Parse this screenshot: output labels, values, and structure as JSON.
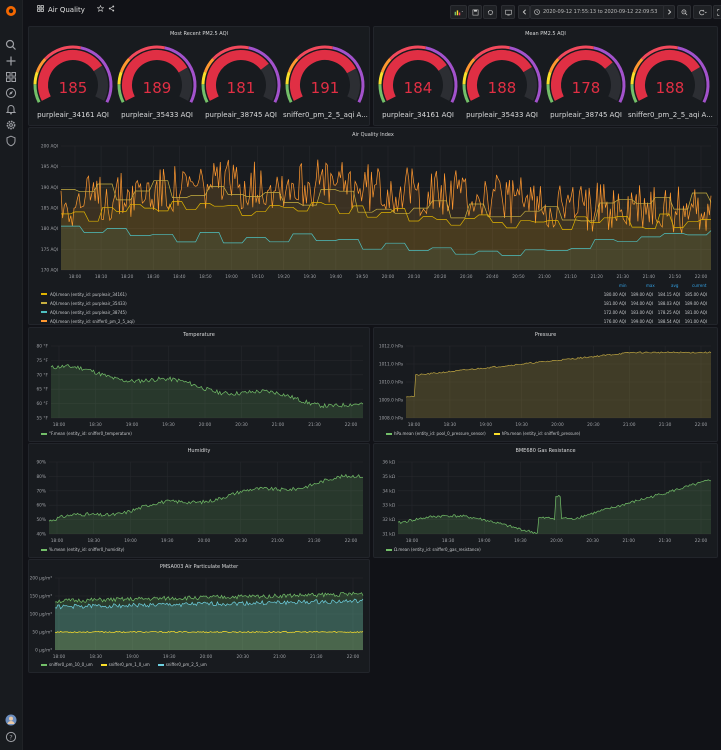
{
  "header": {
    "title": "Air Quality",
    "time_range": "2020-09-12 17:55:13 to 2020-09-12 22:09:53"
  },
  "colors": {
    "bg": "#111217",
    "panel": "#181b1f",
    "red": "#e02f44",
    "green": "#73bf69",
    "orange": "#ff9830",
    "yellow": "#fade2a",
    "teal": "#5794f2",
    "cyan": "#8ab8ff"
  },
  "most_recent": {
    "title": "Most Recent PM2.5 AQI",
    "gauges": [
      {
        "value": "185",
        "label": "purpleair_34161 AQI",
        "fraction": 0.74
      },
      {
        "value": "189",
        "label": "purpleair_35433 AQI",
        "fraction": 0.756
      },
      {
        "value": "181",
        "label": "purpleair_38745 AQI",
        "fraction": 0.724
      },
      {
        "value": "191",
        "label": "sniffer0_pm_2_5_aqi A...",
        "fraction": 0.764
      }
    ]
  },
  "mean": {
    "title": "Mean PM2.5 AQI",
    "gauges": [
      {
        "value": "184",
        "label": "purpleair_34161 AQI",
        "fraction": 0.736
      },
      {
        "value": "188",
        "label": "purpleair_35433 AQI",
        "fraction": 0.752
      },
      {
        "value": "178",
        "label": "purpleair_38745 AQI",
        "fraction": 0.712
      },
      {
        "value": "188",
        "label": "sniffer0_pm_2_5_aqi A...",
        "fraction": 0.752
      }
    ]
  },
  "aqi_panel": {
    "title": "Air Quality Index",
    "y_ticks": [
      "200 AQI",
      "195 AQI",
      "190 AQI",
      "185 AQI",
      "180 AQI",
      "175 AQI",
      "170 AQI"
    ],
    "x_ticks": [
      "18:00",
      "18:10",
      "18:20",
      "18:30",
      "18:40",
      "18:50",
      "19:00",
      "19:10",
      "19:20",
      "19:30",
      "19:40",
      "19:50",
      "20:00",
      "20:10",
      "20:20",
      "20:30",
      "20:40",
      "20:50",
      "21:00",
      "21:10",
      "21:20",
      "21:30",
      "21:40",
      "21:50",
      "22:00"
    ],
    "legend_headers": [
      "min",
      "max",
      "avg",
      "current"
    ],
    "legend": [
      {
        "name": "AQI.mean (entity_id: purpleair_34161)",
        "min": "180.00 AQI",
        "max": "189.00 AQI",
        "avg": "184.15 AQI",
        "current": "185.00 AQI",
        "color": "#e0b400"
      },
      {
        "name": "AQI.mean (entity_id: purpleair_35433)",
        "min": "181.00 AQI",
        "max": "194.00 AQI",
        "avg": "188.03 AQI",
        "current": "189.00 AQI",
        "color": "#c8b040"
      },
      {
        "name": "AQI.mean (entity_id: purpleair_38745)",
        "min": "172.00 AQI",
        "max": "183.00 AQI",
        "avg": "178.25 AQI",
        "current": "181.00 AQI",
        "color": "#4ec0c0"
      },
      {
        "name": "AQI.mean (entity_id: sniffer0_pm_2_5_aqi)",
        "min": "176.00 AQI",
        "max": "199.00 AQI",
        "avg": "188.54 AQI",
        "current": "191.00 AQI",
        "color": "#ff9830"
      }
    ]
  },
  "temperature": {
    "title": "Temperature",
    "y_ticks": [
      "80 °F",
      "75 °F",
      "70 °F",
      "65 °F",
      "60 °F",
      "55 °F"
    ],
    "x_ticks": [
      "18:00",
      "18:30",
      "19:00",
      "19:30",
      "20:00",
      "20:30",
      "21:00",
      "21:30",
      "22:00"
    ],
    "legend": [
      {
        "name": "°F.mean (entity_id: sniffer0_temperature)",
        "color": "#73bf69"
      }
    ]
  },
  "pressure": {
    "title": "Pressure",
    "y_ticks": [
      "1012.0 hPa",
      "1011.0 hPa",
      "1010.0 hPa",
      "1009.0 hPa",
      "1008.0 hPa"
    ],
    "x_ticks": [
      "18:00",
      "18:30",
      "19:00",
      "19:30",
      "20:00",
      "20:30",
      "21:00",
      "21:30",
      "22:00"
    ],
    "legend": [
      {
        "name": "hPa.mean (entity_id: pool_0_pressure_sensor)",
        "color": "#73bf69"
      },
      {
        "name": "hPa.mean (entity_id: sniffer0_pressure)",
        "color": "#fade2a"
      }
    ]
  },
  "humidity": {
    "title": "Humidity",
    "y_ticks": [
      "90%",
      "80%",
      "70%",
      "60%",
      "50%",
      "40%"
    ],
    "x_ticks": [
      "18:00",
      "18:30",
      "19:00",
      "19:30",
      "20:00",
      "20:30",
      "21:00",
      "21:30",
      "22:00"
    ],
    "legend": [
      {
        "name": "%.mean (entity_id: sniffer0_humidity)",
        "color": "#73bf69"
      }
    ]
  },
  "gas": {
    "title": "BME680 Gas Resistance",
    "y_ticks": [
      "36 kΩ",
      "35 kΩ",
      "34 kΩ",
      "33 kΩ",
      "32 kΩ",
      "31 kΩ"
    ],
    "x_ticks": [
      "18:00",
      "18:30",
      "19:00",
      "19:30",
      "20:00",
      "20:30",
      "21:00",
      "21:30",
      "22:00"
    ],
    "legend": [
      {
        "name": "Ω.mean (entity_id: sniffer0_gas_resistance)",
        "color": "#73bf69"
      }
    ]
  },
  "pmsa": {
    "title": "PMSA003 Air Particulate Matter",
    "y_ticks": [
      "200 µg/m³",
      "150 µg/m³",
      "100 µg/m³",
      "50 µg/m³",
      "0 µg/m³"
    ],
    "x_ticks": [
      "18:00",
      "18:30",
      "19:00",
      "19:30",
      "20:00",
      "20:30",
      "21:00",
      "21:30",
      "22:00"
    ],
    "legend": [
      {
        "name": "sniffer0_pm_10_0_um",
        "color": "#73bf69"
      },
      {
        "name": "sniffer0_pm_1_0_um",
        "color": "#fade2a"
      },
      {
        "name": "sniffer0_pm_2_5_um",
        "color": "#6ed0e0"
      }
    ]
  }
}
